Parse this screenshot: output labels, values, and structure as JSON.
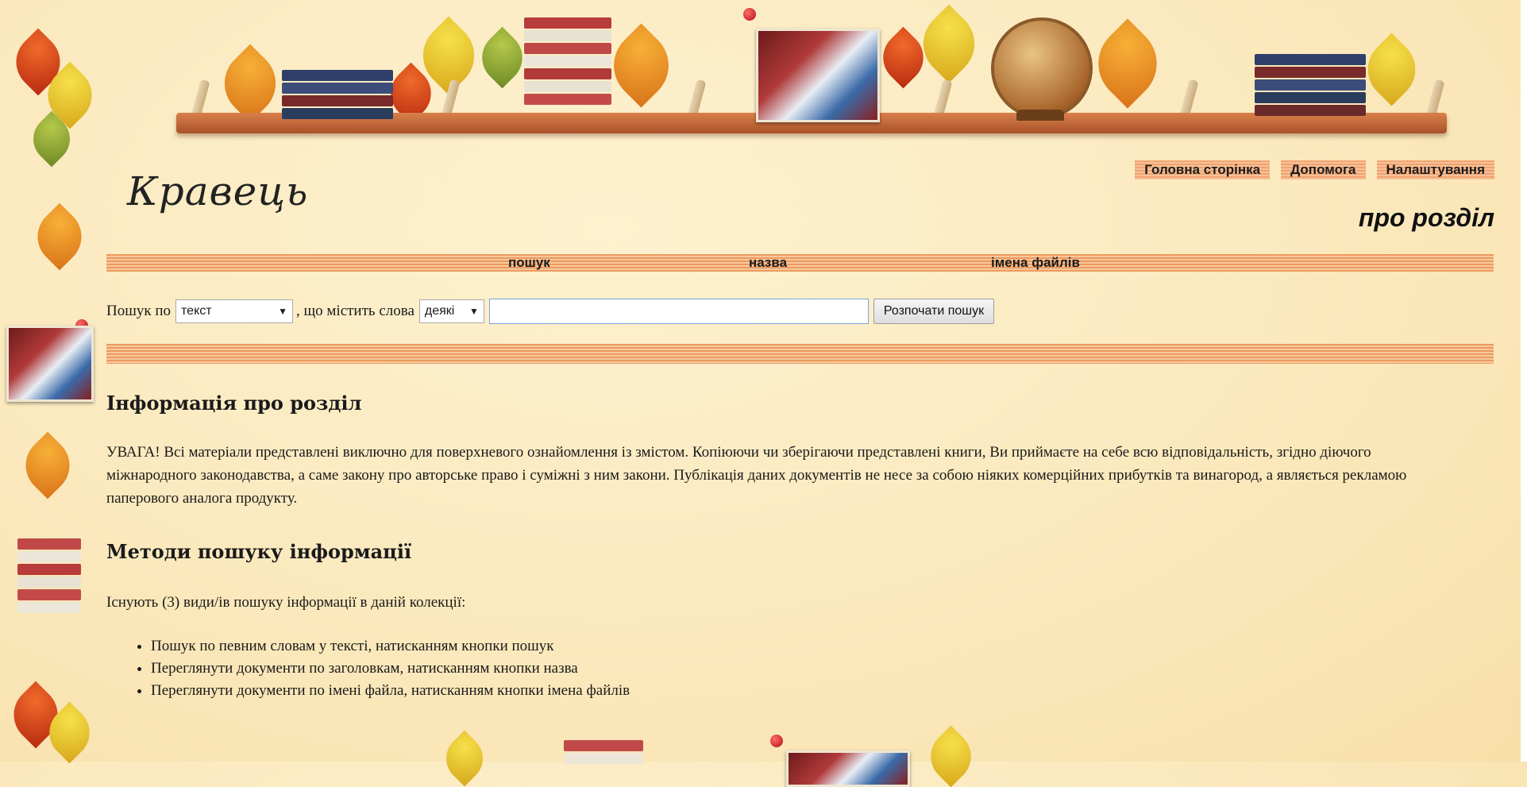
{
  "site": {
    "title": "Кравець"
  },
  "topnav": {
    "home": "Головна сторінка",
    "help": "Допомога",
    "settings": "Налаштування"
  },
  "section_title": "про розділ",
  "navbar": {
    "search": "пошук",
    "title": "назва",
    "filenames": "імена файлів"
  },
  "search": {
    "label_prefix": "Пошук по",
    "field_value": "текст",
    "label_middle": ", що містить слова",
    "match_value": "деякі",
    "query_value": "",
    "button_label": "Розпочати пошук"
  },
  "info": {
    "heading": "Інформація про розділ",
    "text": "УВАГА! Всі матеріали представлені виключно для поверхневого ознайомлення із змістом. Копіюючи чи зберігаючи представлені книги, Ви приймаєте на себе всю відповідальність, згідно діючого міжнародного законодавства, а саме закону про авторське право і суміжні з ним закони. Публікація даних документів не несе за собою ніяких комерційних прибутків та винагород, а являється рекламою паперового аналога продукту."
  },
  "methods": {
    "heading": "Методи пошуку інформації",
    "intro": "Існують (3) види/ів пошуку інформації в даній колекції:",
    "items": [
      "Пошук по певним словам у тексті, натисканням кнопки пошук",
      "Переглянути документи по заголовкам, натисканням кнопки назва",
      "Переглянути документи по імені файла, натисканням кнопки імена файлів"
    ]
  }
}
